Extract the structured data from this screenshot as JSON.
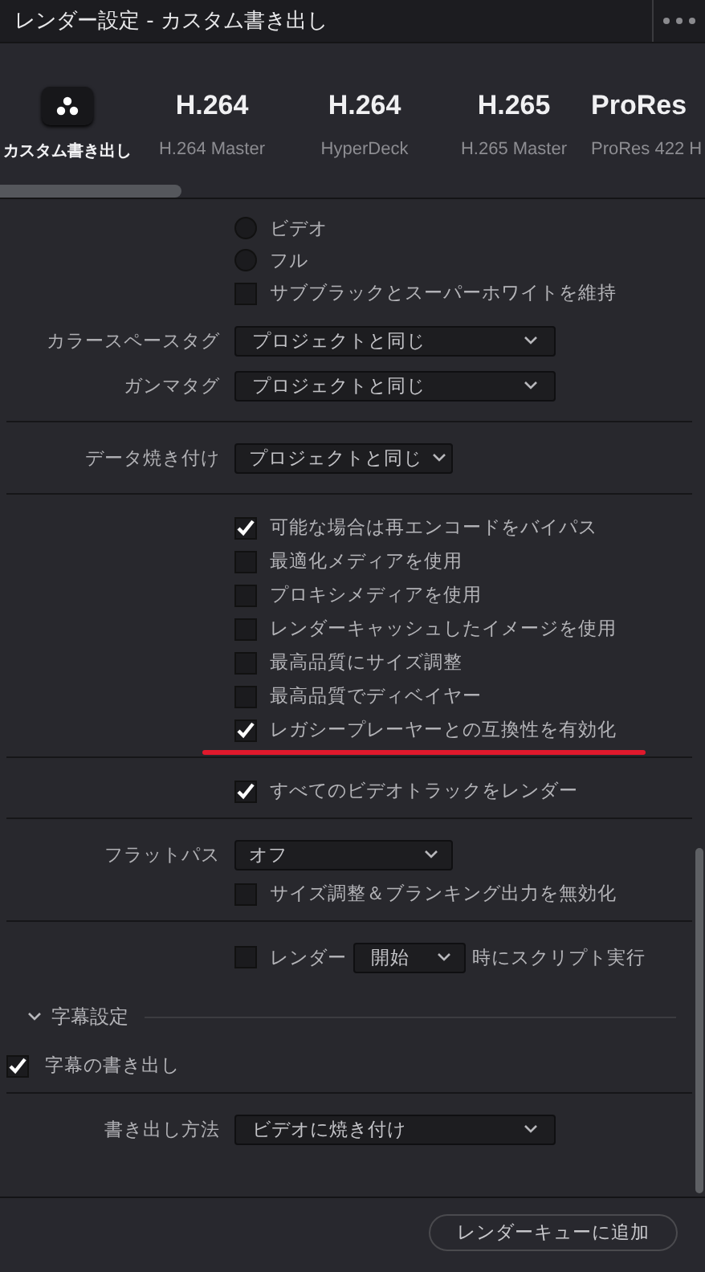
{
  "window": {
    "title": "レンダー設定 - カスタム書き出し"
  },
  "presets": [
    {
      "kind": "logo",
      "label": "カスタム書き出し",
      "selected": true
    },
    {
      "kind": "codec",
      "codec": "H.264",
      "label": "H.264 Master",
      "selected": false
    },
    {
      "kind": "codec",
      "codec": "H.264",
      "label": "HyperDeck",
      "selected": false
    },
    {
      "kind": "codec",
      "codec": "H.265",
      "label": "H.265 Master",
      "selected": false
    },
    {
      "kind": "codec",
      "codec": "ProRes",
      "label": "ProRes 422 H",
      "selected": false
    }
  ],
  "settings": [
    {
      "kind": "radio",
      "label": "ビデオ",
      "selected": false
    },
    {
      "kind": "radio",
      "label": "フル",
      "selected": false
    },
    {
      "kind": "checkbox",
      "label": "サブブラックとスーパーホワイトを維持",
      "checked": false
    },
    {
      "kind": "dropdown",
      "label": "カラースペースタグ",
      "value": "プロジェクトと同じ"
    },
    {
      "kind": "dropdown",
      "label": "ガンマタグ",
      "value": "プロジェクトと同じ"
    },
    {
      "kind": "divider"
    },
    {
      "kind": "compact_dropdown",
      "label": "データ焼き付け",
      "value": "プロジェクトと同じ"
    },
    {
      "kind": "divider"
    },
    {
      "kind": "checkbox",
      "label": "可能な場合は再エンコードをバイパス",
      "checked": true
    },
    {
      "kind": "checkbox",
      "label": "最適化メディアを使用",
      "checked": false
    },
    {
      "kind": "checkbox",
      "label": "プロキシメディアを使用",
      "checked": false
    },
    {
      "kind": "checkbox",
      "label": "レンダーキャッシュしたイメージを使用",
      "checked": false
    },
    {
      "kind": "checkbox",
      "label": "最高品質にサイズ調整",
      "checked": false
    },
    {
      "kind": "checkbox",
      "label": "最高品質でディベイヤー",
      "checked": false
    },
    {
      "kind": "checkbox",
      "label": "レガシープレーヤーとの互換性を有効化",
      "checked": true,
      "highlighted": true
    },
    {
      "kind": "divider"
    },
    {
      "kind": "checkbox",
      "label": "すべてのビデオトラックをレンダー",
      "checked": true
    },
    {
      "kind": "divider"
    },
    {
      "kind": "compact_dropdown",
      "label": "フラットパス",
      "value": "オフ"
    },
    {
      "kind": "checkbox",
      "label": "サイズ調整＆ブランキング出力を無効化",
      "checked": false
    },
    {
      "kind": "divider"
    },
    {
      "kind": "script",
      "checked": false,
      "before": "レンダー",
      "value": "開始",
      "after": "時にスクリプト実行"
    },
    {
      "kind": "section",
      "label": "字幕設定",
      "expanded": true
    },
    {
      "kind": "toplevel_checkbox",
      "label": "字幕の書き出し",
      "checked": true
    },
    {
      "kind": "divider"
    },
    {
      "kind": "dropdown",
      "label": "書き出し方法",
      "value": "ビデオに焼き付け"
    }
  ],
  "footer": {
    "button": "レンダーキューに追加"
  }
}
